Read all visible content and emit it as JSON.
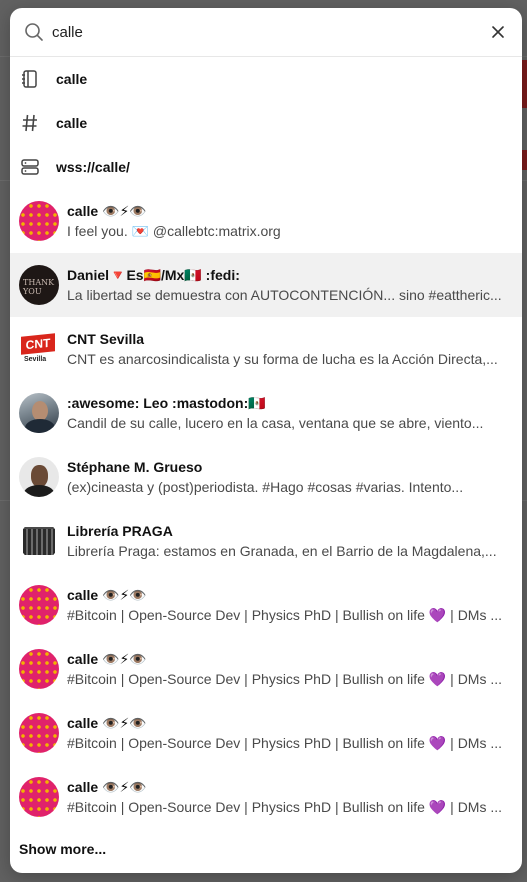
{
  "search": {
    "value": "calle"
  },
  "suggestions": [
    {
      "icon": "notebook-icon",
      "label": "calle"
    },
    {
      "icon": "hashtag-icon",
      "label": "calle"
    },
    {
      "icon": "server-icon",
      "label": "wss://calle/"
    }
  ],
  "users": [
    {
      "name": "calle 👁️⚡👁️",
      "sub": "I feel you. 💌 @callebtc:matrix.org",
      "avatar": "pink"
    },
    {
      "name": "Daniel🔻Es🇪🇸/Mx🇲🇽 :fedi:",
      "sub": "La libertad se demuestra con AUTOCONTENCIÓN... sino #eattheric...",
      "avatar": "dark",
      "avatar_text": "THANK YOU"
    },
    {
      "name": "CNT Sevilla",
      "sub": "CNT es anarcosindicalista y su forma de lucha es la Acción Directa,...",
      "avatar": "cnt",
      "avatar_text": "CNT",
      "avatar_sub": "Sevilla"
    },
    {
      "name": ":awesome: Leo :mastodon:🇲🇽",
      "sub": "Candil de su calle, lucero en la casa, ventana que se abre, viento...",
      "avatar": "leo"
    },
    {
      "name": "Stéphane M. Grueso",
      "sub": "(ex)cineasta y (post)periodista. #Hago #cosas #varias. Intento...",
      "avatar": "steph"
    },
    {
      "name": "Librería PRAGA",
      "sub": "Librería Praga: estamos en Granada, en el Barrio de la Magdalena,...",
      "avatar": "praga"
    },
    {
      "name": "calle 👁️⚡👁️",
      "sub": "#Bitcoin | Open-Source Dev | Physics PhD | Bullish on life 💜 | DMs ...",
      "avatar": "pink"
    },
    {
      "name": "calle 👁️⚡👁️",
      "sub": "#Bitcoin | Open-Source Dev | Physics PhD | Bullish on life 💜 | DMs ...",
      "avatar": "pink"
    },
    {
      "name": "calle 👁️⚡👁️",
      "sub": "#Bitcoin | Open-Source Dev | Physics PhD | Bullish on life 💜 | DMs ...",
      "avatar": "pink"
    },
    {
      "name": "calle 👁️⚡👁️",
      "sub": "#Bitcoin | Open-Source Dev | Physics PhD | Bullish on life 💜 | DMs ...",
      "avatar": "pink"
    }
  ],
  "show_more_label": "Show more..."
}
